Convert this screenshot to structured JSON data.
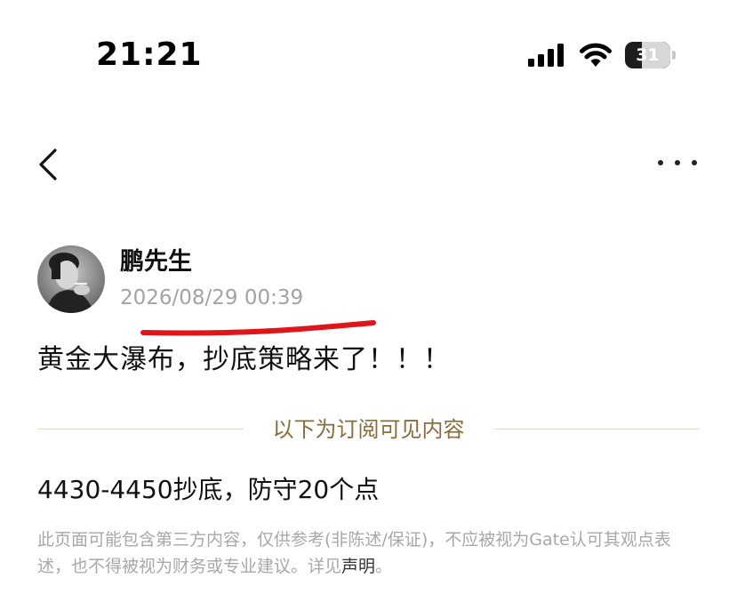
{
  "status_bar": {
    "time": "21:21",
    "battery": "31",
    "battery_level": 0.31
  },
  "nav": {
    "back_icon": "chevron-left-icon",
    "more_icon": "ellipsis-icon"
  },
  "post": {
    "author": "鹏先生",
    "timestamp": "2026/08/29 00:39",
    "headline": "黄金大瀑布，抄底策略来了！！！",
    "subscription_divider": "以下为订阅可见内容",
    "body": "4430-4450抄底，防守20个点",
    "disclaimer_text": "此页面可能包含第三方内容，仅供参考(非陈述/保证)，不应被视为Gate认可其观点表述，也不得被视为财务或专业建议。详见",
    "disclaimer_link": "声明",
    "disclaimer_end": "。"
  },
  "colors": {
    "accent_gold": "#8a6d3b",
    "annotation_red": "#e0141b",
    "muted_text": "#a3a3a3"
  }
}
